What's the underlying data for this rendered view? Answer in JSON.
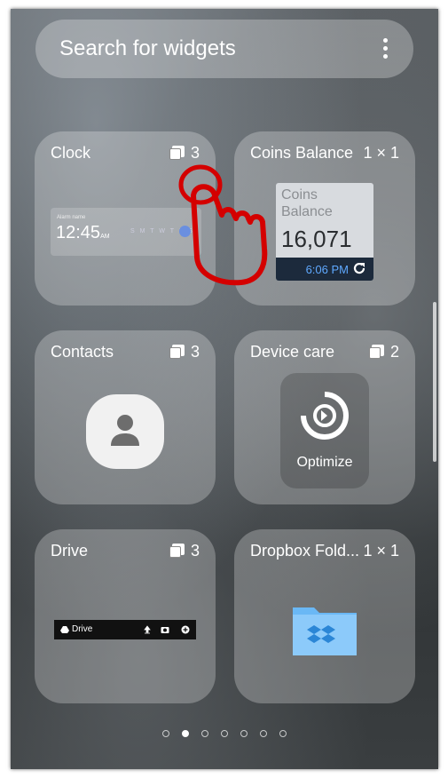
{
  "search": {
    "placeholder": "Search for widgets",
    "menu_icon": "more-vert-icon"
  },
  "widgets": [
    {
      "title": "Clock",
      "count": "3",
      "count_icon": "stack-icon",
      "preview": {
        "alarm_name": "Alarm name",
        "time": "12:45",
        "ampm": "AM",
        "days": "S M T W T F S"
      }
    },
    {
      "title": "Coins Balance",
      "count": "1 × 1",
      "preview": {
        "label": "Coins Balance",
        "value": "16,071",
        "time": "6:06 PM",
        "refresh_icon": "refresh-icon"
      }
    },
    {
      "title": "Contacts",
      "count": "3",
      "count_icon": "stack-icon",
      "preview_icon": "person-icon"
    },
    {
      "title": "Device care",
      "count": "2",
      "count_icon": "stack-icon",
      "preview": {
        "label": "Optimize",
        "icon": "optimize-icon"
      }
    },
    {
      "title": "Drive",
      "count": "3",
      "count_icon": "stack-icon",
      "preview": {
        "label": "Drive",
        "icons": [
          "upload-icon",
          "camera-icon",
          "add-icon"
        ]
      }
    },
    {
      "title": "Dropbox Fold...",
      "count": "1 × 1",
      "preview_icon": "dropbox-folder-icon"
    }
  ],
  "pagination": {
    "count": 7,
    "active": 1
  },
  "colors": {
    "accent_blue": "#5fa9ff",
    "folder_blue": "#6ab8f5",
    "annotation_red": "#d40000"
  }
}
